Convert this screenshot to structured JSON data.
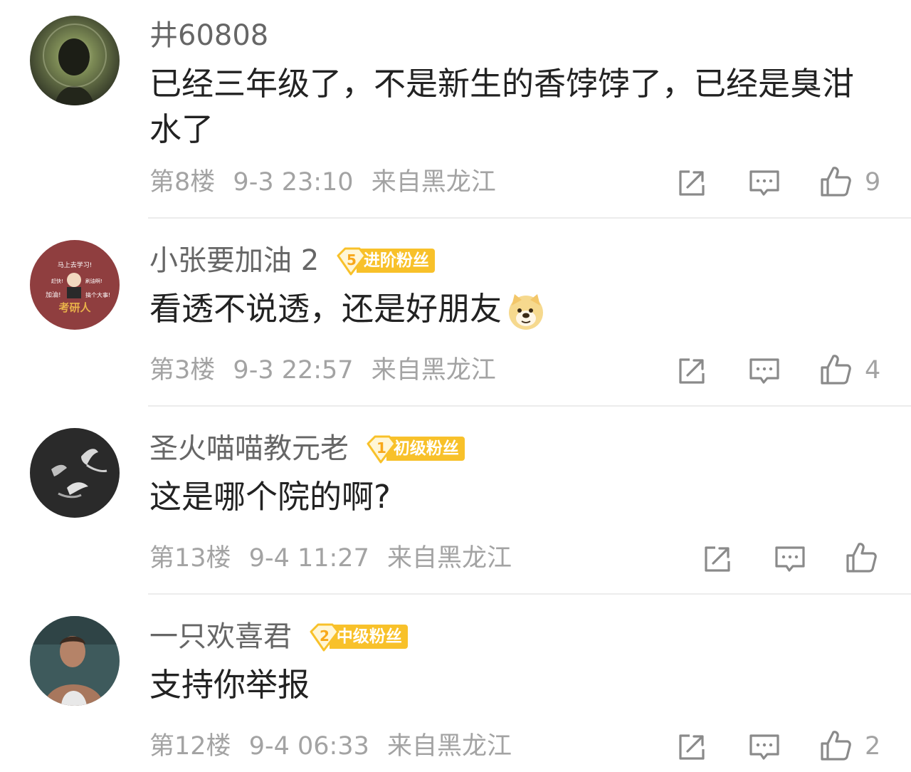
{
  "colors": {
    "badge_gold": "#f8c12a",
    "meta_gray": "#a3a3a3",
    "name_gray": "#666666",
    "text_dark": "#222222"
  },
  "comments": [
    {
      "username": "井60808",
      "content": "已经三年级了，不是新生的香饽饽了，已经是臭泔水了",
      "floor": "第8楼",
      "datetime": "9-3 23:10",
      "location": "来自黑龙江",
      "likes": "9"
    },
    {
      "username": "小张要加油 2",
      "badge_level": "5",
      "badge_label": "进阶粉丝",
      "content": "看透不说透，还是好朋友",
      "emoji": "doge-emoji",
      "floor": "第3楼",
      "datetime": "9-3 22:57",
      "location": "来自黑龙江",
      "likes": "4",
      "avatar_lines": [
        "马上去学习!",
        "赶快!",
        "刷油啊!",
        "加油!",
        "搞个大事!",
        "考研人"
      ]
    },
    {
      "username": "圣火喵喵教元老",
      "badge_level": "1",
      "badge_label": "初级粉丝",
      "content": "这是哪个院的啊?",
      "floor": "第13楼",
      "datetime": "9-4 11:27",
      "location": "来自黑龙江",
      "likes": ""
    },
    {
      "username": "一只欢喜君",
      "badge_level": "2",
      "badge_label": "中级粉丝",
      "content": "支持你举报",
      "floor": "第12楼",
      "datetime": "9-4 06:33",
      "location": "来自黑龙江",
      "likes": "2"
    }
  ],
  "icons": {
    "share": "share-icon",
    "reply": "reply-icon",
    "like": "thumbs-up-icon"
  }
}
